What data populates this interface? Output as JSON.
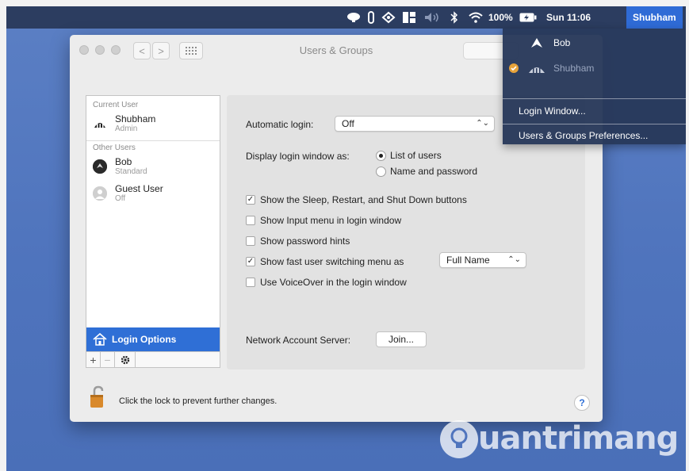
{
  "menubar": {
    "battery": "100%",
    "clock": "Sun 11:06",
    "user": "Shubham",
    "icons": [
      "display-icon",
      "info-icon",
      "sync-icon",
      "grid-icon",
      "volume-icon",
      "bluetooth-icon",
      "wifi-icon",
      "battery-icon"
    ]
  },
  "dropdown": {
    "users": [
      {
        "name": "Bob",
        "active": false
      },
      {
        "name": "Shubham",
        "active": true
      }
    ],
    "items": [
      "Login Window...",
      "Users & Groups Preferences..."
    ]
  },
  "window": {
    "title": "Users & Groups",
    "nav_back": "<",
    "nav_forward": ">"
  },
  "userlist": {
    "current_heading": "Current User",
    "current_user": {
      "name": "Shubham",
      "role": "Admin"
    },
    "other_heading": "Other Users",
    "others": [
      {
        "name": "Bob",
        "role": "Standard"
      },
      {
        "name": "Guest User",
        "role": "Off"
      }
    ],
    "login_options": "Login Options",
    "add": "+",
    "remove": "−"
  },
  "settings": {
    "automatic_login_label": "Automatic login:",
    "automatic_login_value": "Off",
    "display_as_label": "Display login window as:",
    "display_as_options": [
      "List of users",
      "Name and password"
    ],
    "display_as_selected": "List of users",
    "checkboxes": [
      {
        "label": "Show the Sleep, Restart, and Shut Down buttons",
        "checked": true
      },
      {
        "label": "Show Input menu in login window",
        "checked": false
      },
      {
        "label": "Show password hints",
        "checked": false
      },
      {
        "label": "Show fast user switching menu as",
        "checked": true
      },
      {
        "label": "Use VoiceOver in the login window",
        "checked": false
      }
    ],
    "fast_switch_value": "Full Name",
    "network_label": "Network Account Server:",
    "join_button": "Join..."
  },
  "footer": {
    "lock_text": "Click the lock to prevent further changes.",
    "help": "?"
  },
  "watermark": {
    "text": "uantrimang"
  },
  "colors": {
    "menubar": "#2c3d60",
    "accent": "#2f6fd6",
    "desktop": "#5b7fc4"
  }
}
